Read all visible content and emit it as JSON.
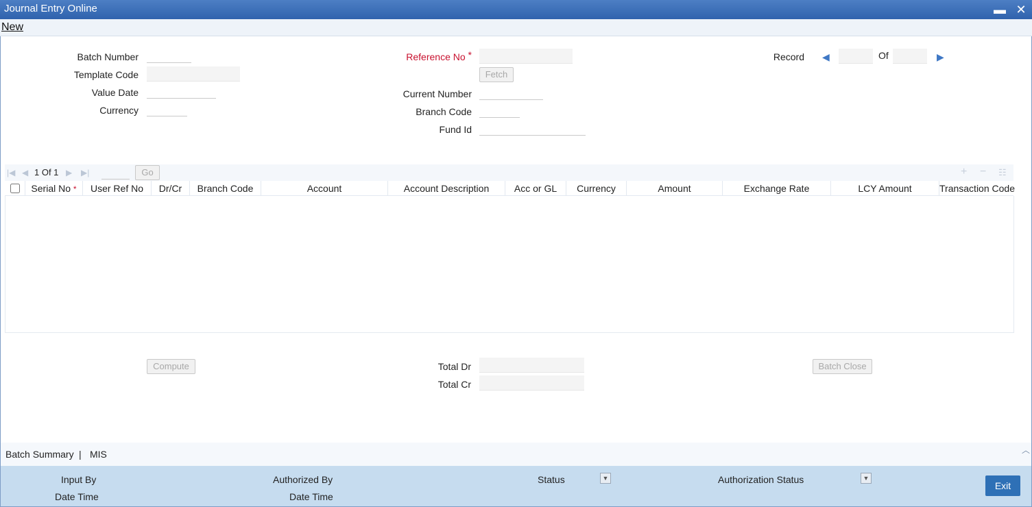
{
  "window": {
    "title": "Journal Entry Online",
    "minimize": "▬",
    "close": "✕"
  },
  "menu": {
    "new_label": "New"
  },
  "header_form": {
    "batch_number_label": "Batch Number",
    "template_code_label": "Template Code",
    "value_date_label": "Value Date",
    "currency_label": "Currency",
    "reference_no_label": "Reference No",
    "required_marker": "*",
    "fetch_label": "Fetch",
    "current_number_label": "Current Number",
    "branch_code_label": "Branch Code",
    "fund_id_label": "Fund Id",
    "record_label": "Record",
    "of_label": "Of"
  },
  "grid": {
    "pager_text": "1 Of 1",
    "go_label": "Go",
    "columns": [
      "Serial No",
      "User Ref No",
      "Dr/Cr",
      "Branch Code",
      "Account",
      "Account Description",
      "Acc or GL",
      "Currency",
      "Amount",
      "Exchange Rate",
      "LCY Amount",
      "Transaction Code"
    ],
    "rows": []
  },
  "totals": {
    "compute_label": "Compute",
    "total_dr_label": "Total Dr",
    "total_cr_label": "Total Cr",
    "batch_close_label": "Batch Close"
  },
  "summary_links": {
    "batch_summary": "Batch Summary",
    "separator": "|",
    "mis": "MIS"
  },
  "footer": {
    "input_by_label": "Input By",
    "date_time_label": "Date Time",
    "authorized_by_label": "Authorized By",
    "date_time_label_2": "Date Time",
    "status_label": "Status",
    "authorization_status_label": "Authorization Status",
    "exit_label": "Exit"
  },
  "colors": {
    "titlebar": "#2f62ad",
    "required": "#c8102e",
    "footer_bg": "#c6dcef",
    "exit_button": "#2e70b6"
  },
  "icons": [
    "minimize-icon",
    "close-icon",
    "prev-record-icon",
    "next-record-icon",
    "first-page-icon",
    "prev-page-icon",
    "next-page-icon",
    "last-page-icon",
    "add-row-icon",
    "delete-row-icon",
    "single-view-icon",
    "dropdown-icon",
    "scroll-up-icon"
  ]
}
